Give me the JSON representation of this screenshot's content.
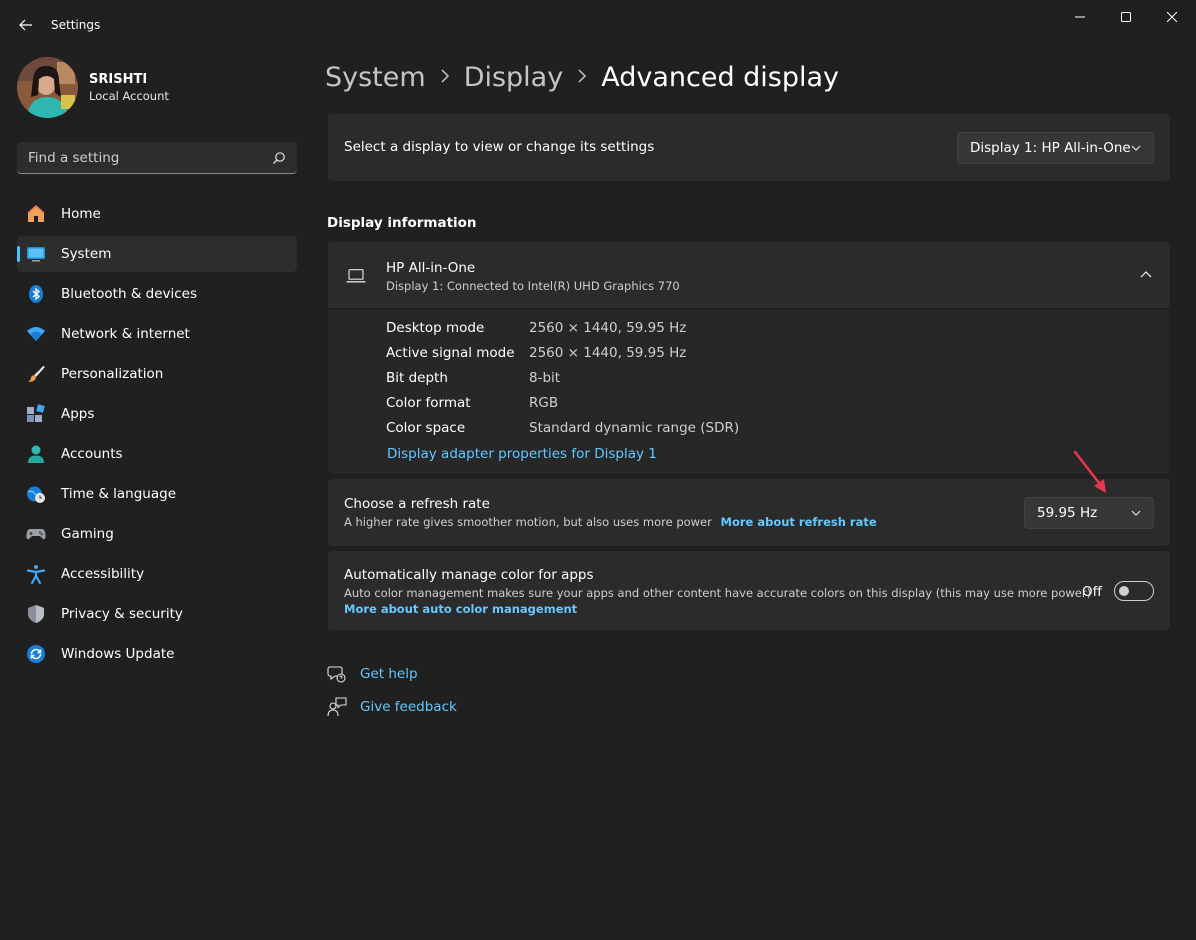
{
  "app": {
    "title": "Settings"
  },
  "profile": {
    "name": "SRISHTI",
    "account_type": "Local Account"
  },
  "search": {
    "placeholder": "Find a setting"
  },
  "sidebar": {
    "items": [
      {
        "label": "Home",
        "icon": "home-icon"
      },
      {
        "label": "System",
        "icon": "system-icon",
        "active": true
      },
      {
        "label": "Bluetooth & devices",
        "icon": "bluetooth-icon"
      },
      {
        "label": "Network & internet",
        "icon": "wifi-icon"
      },
      {
        "label": "Personalization",
        "icon": "brush-icon"
      },
      {
        "label": "Apps",
        "icon": "apps-icon"
      },
      {
        "label": "Accounts",
        "icon": "person-icon"
      },
      {
        "label": "Time & language",
        "icon": "globe-clock-icon"
      },
      {
        "label": "Gaming",
        "icon": "gamepad-icon"
      },
      {
        "label": "Accessibility",
        "icon": "accessibility-icon"
      },
      {
        "label": "Privacy & security",
        "icon": "shield-icon"
      },
      {
        "label": "Windows Update",
        "icon": "update-icon"
      }
    ]
  },
  "breadcrumb": {
    "items": [
      "System",
      "Display",
      "Advanced display"
    ]
  },
  "display_select": {
    "label": "Select a display to view or change its settings",
    "value": "Display 1: HP All-in-One"
  },
  "display_info": {
    "section_title": "Display information",
    "name": "HP All-in-One",
    "subtitle": "Display 1: Connected to Intel(R) UHD Graphics 770",
    "rows": [
      {
        "label": "Desktop mode",
        "value": "2560 × 1440, 59.95 Hz"
      },
      {
        "label": "Active signal mode",
        "value": "2560 × 1440, 59.95 Hz"
      },
      {
        "label": "Bit depth",
        "value": "8-bit"
      },
      {
        "label": "Color format",
        "value": "RGB"
      },
      {
        "label": "Color space",
        "value": "Standard dynamic range (SDR)"
      }
    ],
    "adapter_link": "Display adapter properties for Display 1"
  },
  "refresh_rate": {
    "title": "Choose a refresh rate",
    "description": "A higher rate gives smoother motion, but also uses more power",
    "link": "More about refresh rate",
    "value": "59.95 Hz"
  },
  "auto_color": {
    "title": "Automatically manage color for apps",
    "description": "Auto color management makes sure your apps and other content have accurate colors on this display (this may use more power)",
    "link": "More about auto color management",
    "state_label": "Off"
  },
  "help": {
    "get_help": "Get help",
    "give_feedback": "Give feedback"
  },
  "colors": {
    "accent": "#4cc2ff",
    "link": "#65c8ff",
    "annotation_arrow": "#e8364f"
  }
}
